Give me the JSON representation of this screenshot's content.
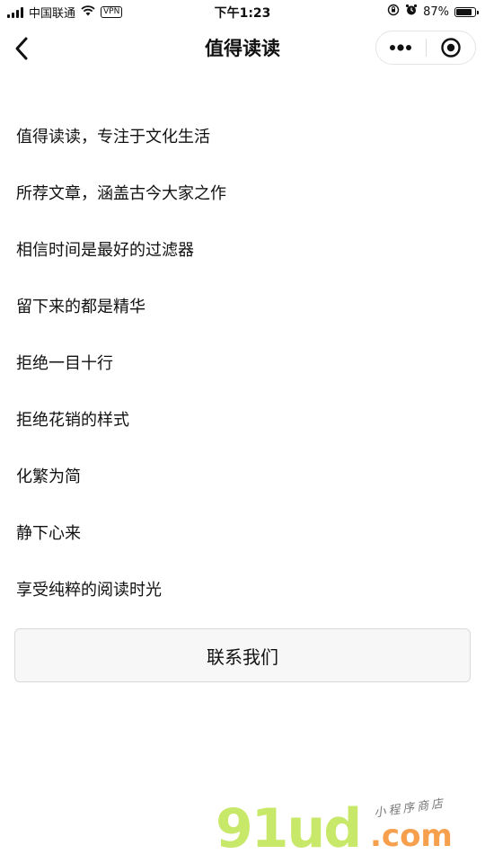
{
  "status_bar": {
    "carrier": "中国联通",
    "vpn": "VPN",
    "time": "下午1:23",
    "battery_percent": "87%",
    "battery_level": 0.87
  },
  "nav": {
    "title": "值得读读",
    "back_icon": "chevron-left-icon",
    "more_icon": "more-dots-icon",
    "close_icon": "target-circle-icon"
  },
  "content": {
    "lines": [
      "值得读读，专注于文化生活",
      "所荐文章，涵盖古今大家之作",
      "相信时间是最好的过滤器",
      "留下来的都是精华",
      "拒绝一目十行",
      "拒绝花销的样式",
      "化繁为简",
      "静下心来",
      "享受纯粹的阅读时光"
    ],
    "contact_button": "联系我们"
  },
  "watermark": {
    "brand": "91ud",
    "domain": ".com",
    "tagline": "小程序商店"
  },
  "colors": {
    "watermark_green": "#c8e86a",
    "watermark_orange": "#f6a04d"
  }
}
